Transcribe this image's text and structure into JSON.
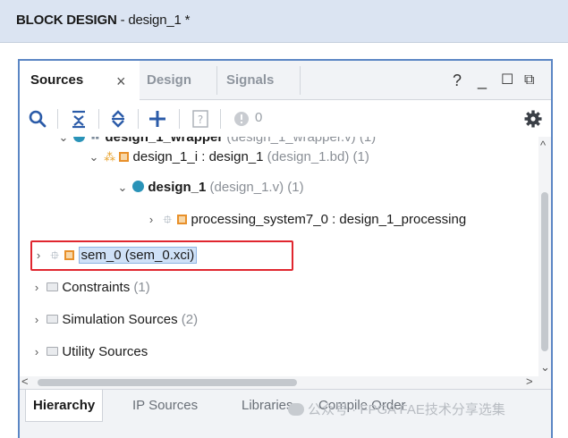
{
  "title_bar": {
    "title_bold": "BLOCK DESIGN",
    "title_rest": " - design_1 *"
  },
  "tabs": [
    {
      "label": "Sources",
      "active": true
    },
    {
      "label": "Design",
      "active": false
    },
    {
      "label": "Signals",
      "active": false
    }
  ],
  "tab_close": "×",
  "window_buttons": {
    "help": "?",
    "minimize": "_",
    "maximize": "☐",
    "restore": "⧉"
  },
  "toolbar": {
    "count": "0"
  },
  "tree": {
    "wrapper": {
      "name": "design_1_wrapper",
      "detail": " (design_1_wrapper.v) (1)"
    },
    "design_1_i": {
      "name": "design_1_i : design_1",
      "detail": " (design_1.bd) (1)"
    },
    "design_1": {
      "name": "design_1",
      "detail": " (design_1.v) (1)"
    },
    "ps7": {
      "name": "processing_system7_0 : design_1_processing"
    },
    "sem_0": {
      "name": "sem_0 (sem_0.xci)"
    },
    "constraints": {
      "name": "Constraints",
      "detail": " (1)"
    },
    "simulation": {
      "name": "Simulation Sources",
      "detail": " (2)"
    },
    "utility": {
      "name": "Utility Sources"
    }
  },
  "bottom_tabs": [
    {
      "label": "Hierarchy",
      "active": true
    },
    {
      "label": "IP Sources",
      "active": false
    },
    {
      "label": "Libraries",
      "active": false
    },
    {
      "label": "Compile Order",
      "active": false
    }
  ],
  "watermark": "公众号 · FPGA FAE技术分享选集",
  "colors": {
    "accent_border": "#5b86c4",
    "highlight_box": "#e0262f",
    "title_bg": "#dbe4f2"
  }
}
